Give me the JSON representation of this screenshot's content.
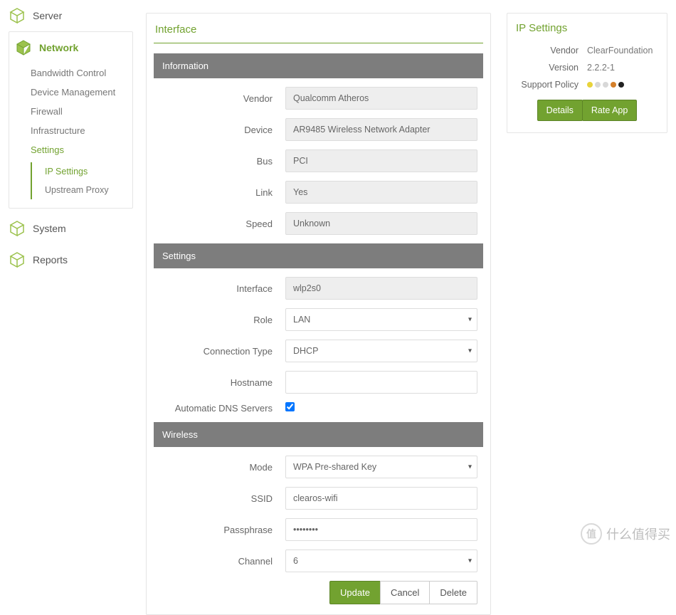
{
  "sidebar": {
    "server": "Server",
    "network": "Network",
    "network_sub": [
      "Bandwidth Control",
      "Device Management",
      "Firewall",
      "Infrastructure",
      "Settings"
    ],
    "settings_sub": [
      "IP Settings",
      "Upstream Proxy"
    ],
    "system": "System",
    "reports": "Reports"
  },
  "main": {
    "title": "Interface",
    "information": {
      "header": "Information",
      "labels": {
        "vendor": "Vendor",
        "device": "Device",
        "bus": "Bus",
        "link": "Link",
        "speed": "Speed"
      },
      "values": {
        "vendor": "Qualcomm Atheros",
        "device": "AR9485 Wireless Network Adapter",
        "bus": "PCI",
        "link": "Yes",
        "speed": "Unknown"
      }
    },
    "settings": {
      "header": "Settings",
      "labels": {
        "interface": "Interface",
        "role": "Role",
        "conn_type": "Connection Type",
        "hostname": "Hostname",
        "auto_dns": "Automatic DNS Servers"
      },
      "values": {
        "interface": "wlp2s0",
        "role": "LAN",
        "conn_type": "DHCP",
        "hostname": "",
        "auto_dns": true
      }
    },
    "wireless": {
      "header": "Wireless",
      "labels": {
        "mode": "Mode",
        "ssid": "SSID",
        "pass": "Passphrase",
        "channel": "Channel"
      },
      "values": {
        "mode": "WPA Pre-shared Key",
        "ssid": "clearos-wifi",
        "pass": "••••••••",
        "channel": "6"
      }
    },
    "buttons": {
      "update": "Update",
      "cancel": "Cancel",
      "delete": "Delete"
    }
  },
  "side": {
    "title": "IP Settings",
    "labels": {
      "vendor": "Vendor",
      "version": "Version",
      "support": "Support Policy"
    },
    "values": {
      "vendor": "ClearFoundation",
      "version": "2.2.2-1"
    },
    "dots": [
      "#e8d33a",
      "#d8d8d8",
      "#d8d8d8",
      "#d47f2a",
      "#222"
    ],
    "buttons": {
      "details": "Details",
      "rate": "Rate App"
    }
  },
  "watermark": "什么值得买"
}
